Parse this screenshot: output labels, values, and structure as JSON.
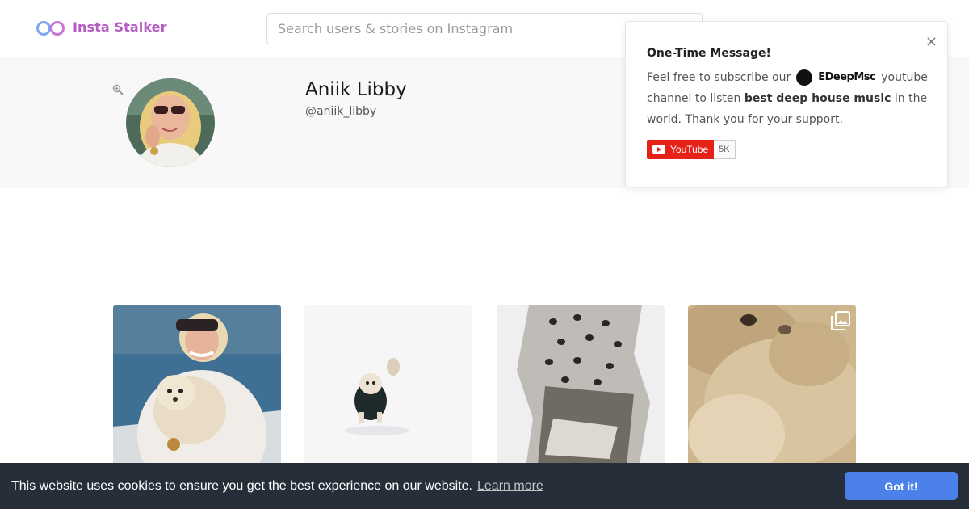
{
  "header": {
    "logo_text": "Insta Stalker",
    "search_placeholder": "Search users & stories on Instagram"
  },
  "profile": {
    "full_name": "Aniik Libby",
    "username": "@aniik_libby"
  },
  "popup": {
    "title": "One-Time Message!",
    "text_before": "Feel free to subscribe our",
    "channel_name": "EDeepMsc",
    "text_after": "youtube channel to listen",
    "bold_text": "best deep house music",
    "text_end": "in the world. Thank you for your support.",
    "close_glyph": "×",
    "youtube_label": "YouTube",
    "youtube_count": "5K"
  },
  "posts": [
    {
      "description": "woman with small dog on boat",
      "gallery": false
    },
    {
      "description": "small dog running in snow",
      "gallery": false
    },
    {
      "description": "textured tree bark",
      "gallery": false
    },
    {
      "description": "fluffy dog close-up",
      "gallery": true
    }
  ],
  "cookie": {
    "message": "This website uses cookies to ensure you get the best experience on our website.",
    "learn_more": "Learn more",
    "button": "Got it!"
  },
  "colors": {
    "brand": "#b65bc4",
    "cookie_bg": "#252e39",
    "cookie_button": "#4b81e8",
    "youtube_red": "#e62117"
  },
  "icons": {
    "logo": "glasses-icon",
    "zoom": "zoom-in-icon",
    "close": "close-icon",
    "gallery": "gallery-icon"
  }
}
